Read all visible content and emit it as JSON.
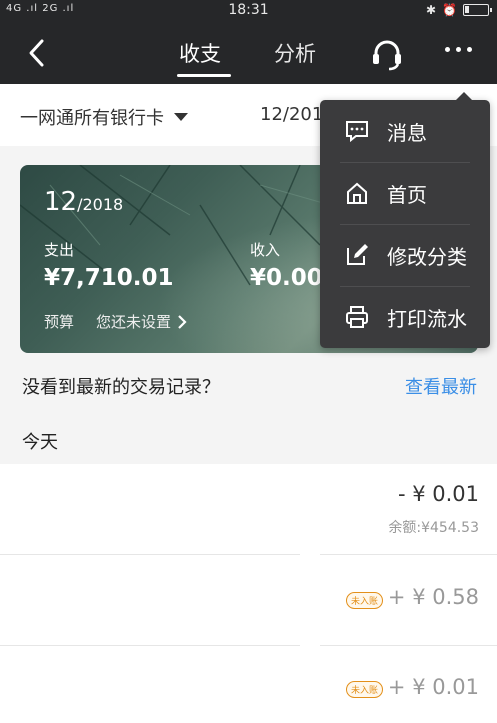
{
  "status_bar": {
    "signal": "4G .ıl 2G .ıl",
    "time": "18:31",
    "icons": [
      "bluetooth-icon",
      "alarm-icon",
      "battery-icon"
    ],
    "battery_level": 0.15
  },
  "nav": {
    "tabs": [
      "收支",
      "分析"
    ],
    "active_tab": "收支",
    "back_icon": "chevron-left-icon",
    "service_icon": "headset-icon",
    "more_icon": "more-dots-icon"
  },
  "filter": {
    "card": "一网通所有银行卡",
    "date": "12/201"
  },
  "summary": {
    "month": "12",
    "year": "/2018",
    "expense_label": "支出",
    "expense_value": "¥7,710.01",
    "income_label": "收入",
    "income_value": "¥0.00",
    "budget_label": "预算",
    "budget_value": "您还未设置"
  },
  "notice": {
    "text": "没看到最新的交易记录？",
    "action": "查看最新"
  },
  "section": {
    "today": "今天"
  },
  "transactions": [
    {
      "amount": "- ¥ 0.01",
      "balance": "余额:¥454.53"
    },
    {
      "badge": "未入账",
      "amount": "+ ¥ 0.58"
    },
    {
      "badge": "未入账",
      "amount": "+ ¥ 0.01"
    }
  ],
  "menu": {
    "items": [
      {
        "label": "消息",
        "icon": "message-icon"
      },
      {
        "label": "首页",
        "icon": "home-icon"
      },
      {
        "label": "修改分类",
        "icon": "edit-icon"
      },
      {
        "label": "打印流水",
        "icon": "printer-icon"
      }
    ]
  },
  "colors": {
    "nav_bg": "#262729",
    "link_blue": "#3a8ee6",
    "badge_orange": "#e3901b",
    "menu_bg": "#3b3b3d"
  }
}
